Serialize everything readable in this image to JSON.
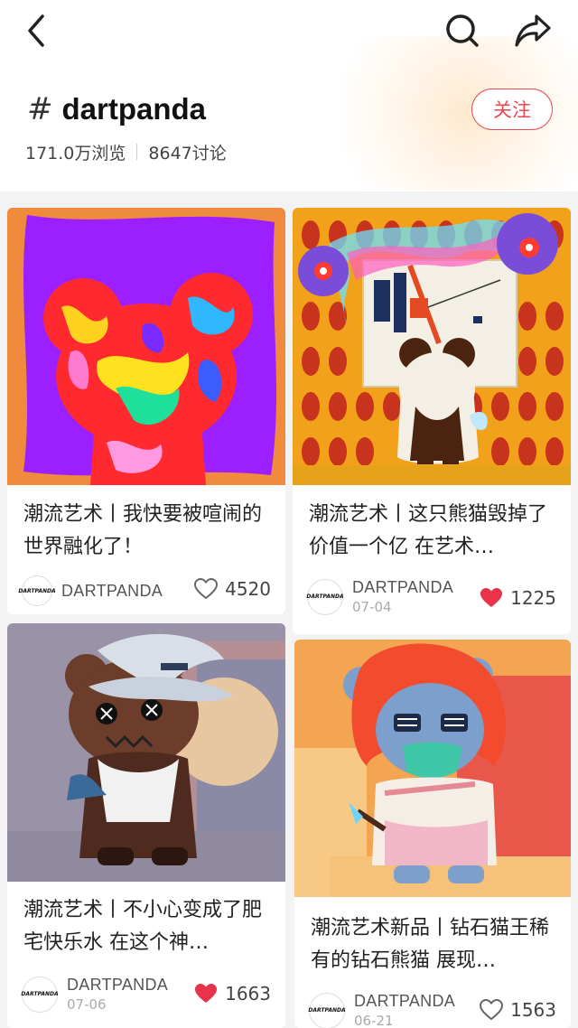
{
  "header": {
    "hash": "#",
    "topic": "dartpanda",
    "views": "171.0万浏览",
    "discussions": "8647讨论",
    "follow_label": "关注"
  },
  "cards": [
    {
      "title": "潮流艺术丨我快要被喧闹的世界融化了！",
      "author": "DARTPANDA",
      "date": "",
      "likes": "4520",
      "liked": false
    },
    {
      "title": "潮流艺术丨这只熊猫毁掉了价值一个亿 在艺术…",
      "author": "DARTPANDA",
      "date": "07-04",
      "likes": "1225",
      "liked": true
    },
    {
      "title": "潮流艺术丨不小心变成了肥宅快乐水 在这个神…",
      "author": "DARTPANDA",
      "date": "07-06",
      "likes": "1663",
      "liked": true
    },
    {
      "title": "潮流艺术新品丨钻石猫王稀有的钻石熊猫 展现…",
      "author": "DARTPANDA",
      "date": "06-21",
      "likes": "1563",
      "liked": false
    }
  ],
  "avatar_text": "DARTPANDA",
  "colors": {
    "accent": "#e84a55",
    "liked": "#e8334a"
  }
}
